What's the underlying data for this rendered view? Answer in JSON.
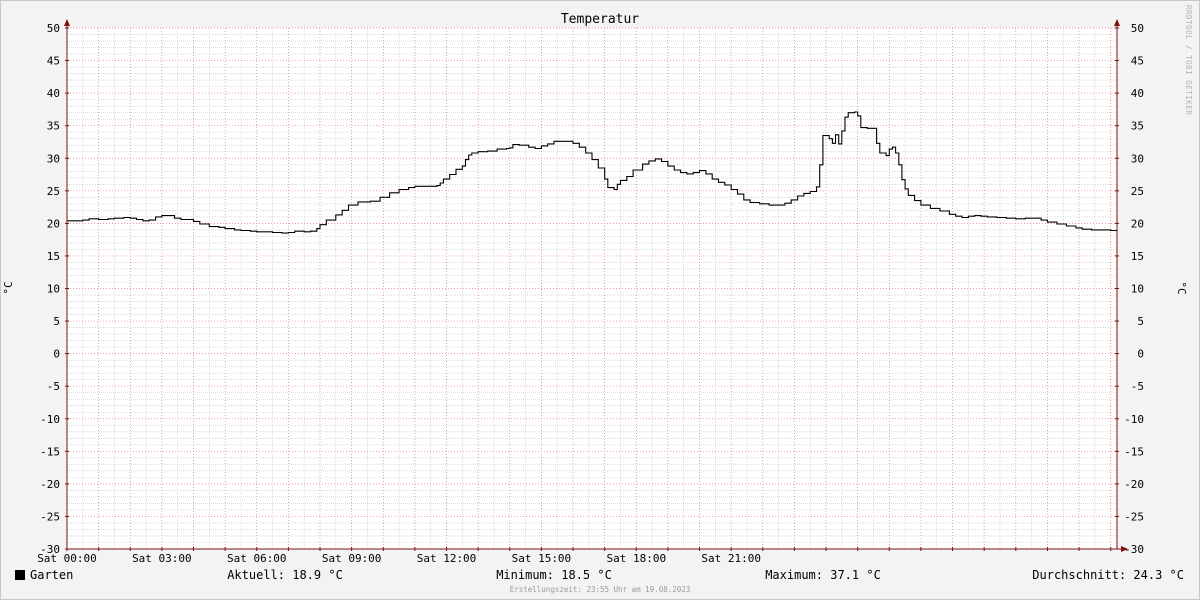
{
  "chart_data": {
    "type": "line",
    "title": "Temperatur",
    "ylabel_left": "°C",
    "ylabel_right": "°C",
    "ylim": [
      -30,
      50
    ],
    "ystep": 5,
    "ytick_labels": [
      "-30",
      "-25",
      "-20",
      "-15",
      "-10",
      "-5",
      "0",
      "5",
      "10",
      "15",
      "20",
      "25",
      "30",
      "35",
      "40",
      "45",
      "50"
    ],
    "xlim": [
      0,
      24
    ],
    "xticks": [
      {
        "hour": 0,
        "label": "Sat 00:00"
      },
      {
        "hour": 3,
        "label": "Sat 03:00"
      },
      {
        "hour": 6,
        "label": "Sat 06:00"
      },
      {
        "hour": 9,
        "label": "Sat 09:00"
      },
      {
        "hour": 12,
        "label": "Sat 12:00"
      },
      {
        "hour": 15,
        "label": "Sat 15:00"
      },
      {
        "hour": 18,
        "label": "Sat 18:00"
      },
      {
        "hour": 21,
        "label": "Sat 21:00"
      }
    ],
    "grid": true,
    "series": [
      {
        "name": "Garten",
        "color": "#000000",
        "points": [
          [
            0.0,
            20.4
          ],
          [
            0.3,
            20.4
          ],
          [
            0.5,
            20.5
          ],
          [
            0.7,
            20.7
          ],
          [
            1.0,
            20.6
          ],
          [
            1.3,
            20.7
          ],
          [
            1.5,
            20.8
          ],
          [
            1.8,
            20.9
          ],
          [
            2.0,
            20.8
          ],
          [
            2.2,
            20.6
          ],
          [
            2.4,
            20.4
          ],
          [
            2.6,
            20.5
          ],
          [
            2.8,
            21.0
          ],
          [
            3.0,
            21.2
          ],
          [
            3.2,
            21.2
          ],
          [
            3.4,
            20.8
          ],
          [
            3.6,
            20.6
          ],
          [
            3.8,
            20.6
          ],
          [
            4.0,
            20.3
          ],
          [
            4.2,
            19.9
          ],
          [
            4.5,
            19.5
          ],
          [
            4.8,
            19.4
          ],
          [
            5.0,
            19.2
          ],
          [
            5.3,
            19.0
          ],
          [
            5.5,
            18.9
          ],
          [
            5.8,
            18.8
          ],
          [
            6.0,
            18.7
          ],
          [
            6.2,
            18.7
          ],
          [
            6.5,
            18.6
          ],
          [
            6.8,
            18.5
          ],
          [
            7.0,
            18.6
          ],
          [
            7.2,
            18.8
          ],
          [
            7.5,
            18.7
          ],
          [
            7.7,
            18.8
          ],
          [
            7.9,
            19.2
          ],
          [
            8.0,
            19.8
          ],
          [
            8.2,
            20.5
          ],
          [
            8.5,
            21.3
          ],
          [
            8.7,
            22.0
          ],
          [
            8.9,
            22.8
          ],
          [
            9.2,
            23.3
          ],
          [
            9.6,
            23.4
          ],
          [
            9.9,
            24.0
          ],
          [
            10.2,
            24.7
          ],
          [
            10.5,
            25.2
          ],
          [
            10.8,
            25.5
          ],
          [
            11.0,
            25.7
          ],
          [
            11.3,
            25.7
          ],
          [
            11.5,
            25.7
          ],
          [
            11.7,
            25.8
          ],
          [
            11.8,
            26.2
          ],
          [
            11.9,
            26.8
          ],
          [
            12.1,
            27.5
          ],
          [
            12.3,
            28.3
          ],
          [
            12.5,
            28.8
          ],
          [
            12.6,
            29.8
          ],
          [
            12.7,
            30.5
          ],
          [
            12.8,
            30.8
          ],
          [
            13.0,
            31.0
          ],
          [
            13.3,
            31.1
          ],
          [
            13.6,
            31.4
          ],
          [
            13.9,
            31.5
          ],
          [
            14.0,
            31.6
          ],
          [
            14.1,
            32.1
          ],
          [
            14.3,
            32.0
          ],
          [
            14.6,
            31.7
          ],
          [
            14.8,
            31.5
          ],
          [
            15.0,
            31.9
          ],
          [
            15.2,
            32.2
          ],
          [
            15.4,
            32.6
          ],
          [
            15.6,
            32.6
          ],
          [
            15.8,
            32.6
          ],
          [
            16.0,
            32.3
          ],
          [
            16.2,
            31.7
          ],
          [
            16.4,
            30.8
          ],
          [
            16.6,
            29.8
          ],
          [
            16.8,
            28.5
          ],
          [
            17.0,
            26.8
          ],
          [
            17.1,
            25.5
          ],
          [
            17.3,
            25.2
          ],
          [
            17.4,
            26.0
          ],
          [
            17.5,
            26.6
          ],
          [
            17.7,
            27.2
          ],
          [
            17.9,
            28.2
          ],
          [
            18.2,
            29.1
          ],
          [
            18.4,
            29.6
          ],
          [
            18.6,
            29.9
          ],
          [
            18.8,
            29.5
          ],
          [
            19.0,
            28.8
          ],
          [
            19.2,
            28.2
          ],
          [
            19.4,
            27.8
          ],
          [
            19.6,
            27.6
          ],
          [
            19.8,
            27.8
          ],
          [
            20.0,
            28.1
          ],
          [
            20.2,
            27.6
          ],
          [
            20.4,
            26.8
          ],
          [
            20.6,
            26.3
          ],
          [
            20.8,
            25.9
          ],
          [
            21.0,
            25.2
          ],
          [
            21.2,
            24.5
          ],
          [
            21.4,
            23.6
          ],
          [
            21.6,
            23.2
          ],
          [
            21.9,
            23.0
          ],
          [
            22.2,
            22.8
          ],
          [
            22.5,
            22.8
          ],
          [
            22.7,
            23.1
          ],
          [
            22.9,
            23.6
          ],
          [
            23.1,
            24.2
          ],
          [
            23.3,
            24.6
          ],
          [
            23.5,
            24.9
          ],
          [
            23.7,
            25.6
          ],
          [
            23.8,
            29.0
          ],
          [
            23.9,
            33.5
          ],
          [
            24.1,
            33.0
          ],
          [
            24.2,
            32.3
          ],
          [
            24.3,
            33.6
          ],
          [
            24.4,
            32.2
          ],
          [
            24.5,
            34.2
          ],
          [
            24.6,
            36.3
          ],
          [
            24.7,
            37.0
          ],
          [
            24.9,
            37.1
          ],
          [
            25.0,
            36.5
          ],
          [
            25.1,
            34.7
          ],
          [
            25.3,
            34.6
          ],
          [
            25.5,
            34.6
          ],
          [
            25.6,
            32.3
          ],
          [
            25.7,
            30.8
          ],
          [
            25.9,
            30.4
          ],
          [
            26.0,
            31.4
          ],
          [
            26.1,
            31.7
          ],
          [
            26.2,
            30.8
          ],
          [
            26.3,
            29.0
          ],
          [
            26.4,
            26.7
          ],
          [
            26.5,
            25.3
          ],
          [
            26.6,
            24.3
          ],
          [
            26.8,
            23.5
          ],
          [
            27.0,
            22.8
          ],
          [
            27.3,
            22.3
          ],
          [
            27.6,
            21.9
          ],
          [
            27.9,
            21.4
          ],
          [
            28.1,
            21.1
          ],
          [
            28.3,
            20.9
          ],
          [
            28.5,
            21.1
          ],
          [
            28.7,
            21.2
          ],
          [
            28.9,
            21.1
          ],
          [
            29.1,
            21.0
          ],
          [
            29.4,
            20.9
          ],
          [
            29.7,
            20.8
          ],
          [
            30.0,
            20.7
          ],
          [
            30.3,
            20.8
          ],
          [
            30.6,
            20.8
          ],
          [
            30.8,
            20.5
          ],
          [
            31.0,
            20.2
          ],
          [
            31.3,
            19.9
          ],
          [
            31.6,
            19.6
          ],
          [
            31.9,
            19.3
          ],
          [
            32.1,
            19.1
          ],
          [
            32.4,
            19.0
          ],
          [
            32.7,
            19.0
          ],
          [
            33.0,
            18.9
          ],
          [
            33.2,
            18.8
          ]
        ]
      }
    ],
    "x_domain": [
      0,
      33.2
    ]
  },
  "legend": {
    "series_name": "Garten",
    "aktuell": "Aktuell: 18.9 °C",
    "minimum": "Minimum: 18.5 °C",
    "maximum": "Maximum: 37.1 °C",
    "durchschnitt": "Durchschnitt: 24.3 °C"
  },
  "footer": {
    "created": "Erstellungszeit: 23:55 Uhr am 19.08.2023"
  },
  "watermark": "RRDTOOL / TOBI OETIKER",
  "colors": {
    "background": "#f3f3f3",
    "canvas": "#ffffff",
    "major_grid": "#e87a7a",
    "minor_grid": "#c8c8c8",
    "axis": "#7a1010",
    "line": "#000000"
  }
}
